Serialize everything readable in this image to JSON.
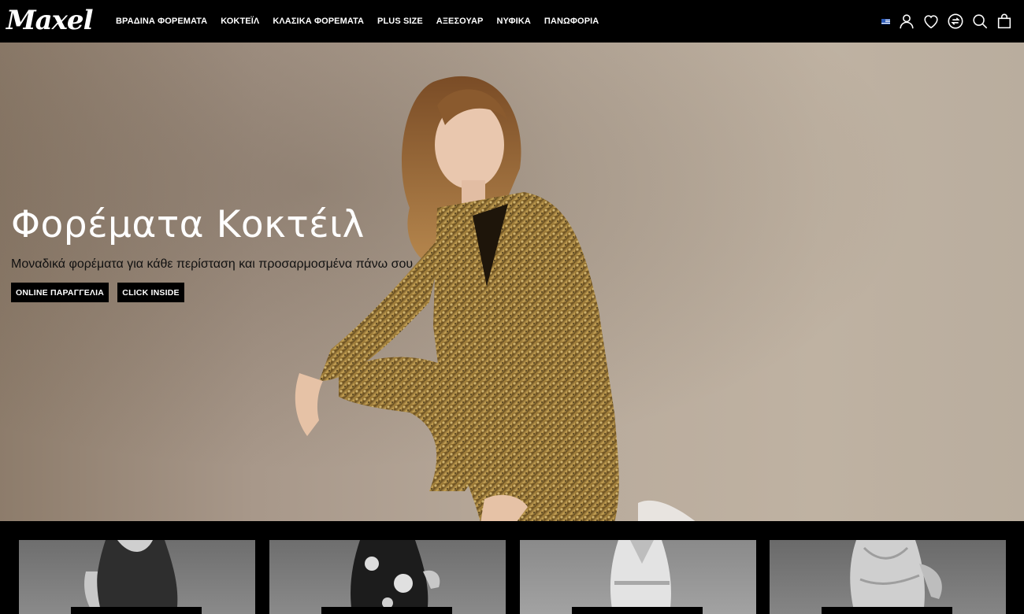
{
  "brand": {
    "logo_text": "Maxel"
  },
  "nav": {
    "items": [
      {
        "label": "ΒΡΑΔΙΝΑ ΦΟΡΕΜΑΤΑ"
      },
      {
        "label": "ΚΟΚΤΕΪΛ"
      },
      {
        "label": "ΚΛΑΣΙΚΑ ΦΟΡΕΜΑΤΑ"
      },
      {
        "label": "PLUS SIZE"
      },
      {
        "label": "ΑΞΕΣΟΥΑΡ"
      },
      {
        "label": "ΝΥΦΙΚΑ"
      },
      {
        "label": "ΠΑΝΩΦΟΡΙΑ"
      }
    ]
  },
  "header_icons": [
    "greek-flag-icon",
    "user-icon",
    "heart-icon",
    "compare-icon",
    "search-icon",
    "shopping-bag-icon"
  ],
  "hero": {
    "title": "Φορέματα Κοκτέιλ",
    "subtitle": "Μοναδικά φορέματα για κάθε περίσταση και προσαρμοσμένα πάνω σου",
    "button_primary": "ONLINE ΠΑΡΑΓΓΕΛΙΑ",
    "button_secondary": "CLICK INSIDE"
  },
  "colors": {
    "header_bg": "#000000",
    "hero_bg": "#b5a796",
    "dress_gold": "#8a6a2a",
    "button_bg": "#000000"
  }
}
